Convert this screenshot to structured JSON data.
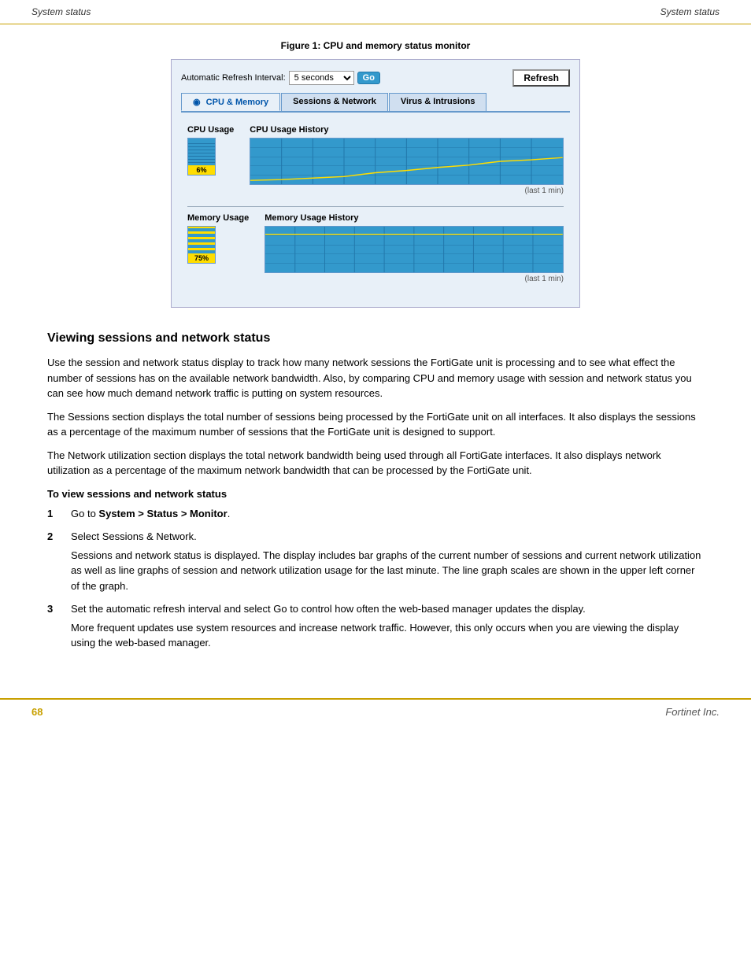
{
  "header": {
    "left_title": "System status",
    "right_title": "System status"
  },
  "figure": {
    "caption": "Figure 1:   CPU and memory status monitor",
    "toolbar": {
      "label": "Automatic Refresh Interval:",
      "interval_value": "5 seconds",
      "go_label": "Go",
      "refresh_label": "Refresh"
    },
    "tabs": [
      {
        "label": "CPU & Memory",
        "active": true,
        "icon": true
      },
      {
        "label": "Sessions & Network",
        "active": false,
        "icon": false
      },
      {
        "label": "Virus & Intrusions",
        "active": false,
        "icon": false
      }
    ],
    "cpu_usage": {
      "label": "CPU Usage",
      "value": "6%",
      "fill_percent": 6
    },
    "cpu_history": {
      "label": "CPU Usage History",
      "last_min": "(last 1 min)"
    },
    "memory_usage": {
      "label": "Memory Usage",
      "value": "75%",
      "fill_percent": 75
    },
    "memory_history": {
      "label": "Memory Usage History",
      "last_min": "(last 1 min)"
    }
  },
  "section": {
    "heading": "Viewing sessions and network status",
    "paragraphs": [
      "Use the session and network status display to track how many network sessions the FortiGate unit is processing and to see what effect the number of sessions has on the available network bandwidth. Also, by comparing CPU and memory usage with session and network status you can see how much demand network traffic is putting on system resources.",
      "The Sessions section displays the total number of sessions being processed by the FortiGate unit on all interfaces. It also displays the sessions as a percentage of the maximum number of sessions that the FortiGate unit is designed to support.",
      "The Network utilization section displays the total network bandwidth being used through all FortiGate interfaces. It also displays network utilization as a percentage of the maximum network bandwidth that can be processed by the FortiGate unit."
    ],
    "procedure_heading": "To view sessions and network status",
    "steps": [
      {
        "number": "1",
        "text": "Go to ",
        "bold_text": "System > Status > Monitor",
        "suffix": "."
      },
      {
        "number": "2",
        "text": "Select Sessions & Network."
      },
      {
        "number": "3",
        "text": "Set the automatic refresh interval and select Go to control how often the web-based manager updates the display.",
        "note": "More frequent updates use system resources and increase network traffic. However, this only occurs when you are viewing the display using the web-based manager."
      }
    ],
    "step2_note": "Sessions and network status is displayed. The display includes bar graphs of the current number of sessions and current network utilization as well as line graphs of session and network utilization usage for the last minute. The line graph scales are shown in the upper left corner of the graph."
  },
  "footer": {
    "page": "68",
    "brand": "Fortinet Inc."
  }
}
